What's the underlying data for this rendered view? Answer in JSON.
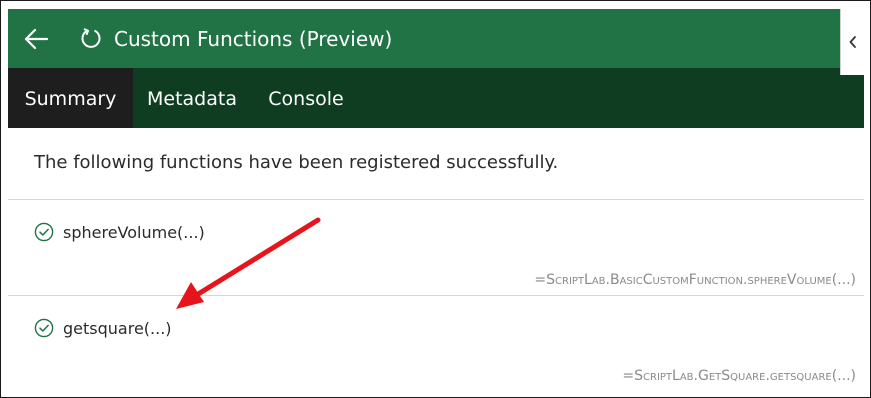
{
  "header": {
    "title": "Custom Functions (Preview)",
    "back_icon": "back-arrow-icon",
    "refresh_icon": "refresh-icon",
    "collapse_icon": "chevron-left-icon",
    "colors": {
      "header_bg": "#217346",
      "tabbar_bg": "#0f3d22",
      "active_tab_bg": "#1e1e1e"
    }
  },
  "tabs": [
    {
      "label": "Summary",
      "active": true
    },
    {
      "label": "Metadata",
      "active": false
    },
    {
      "label": "Console",
      "active": false
    }
  ],
  "main": {
    "message": "The following functions have been registered successfully.",
    "functions": [
      {
        "name": "sphereVolume(...)",
        "formula": "=ScriptLab.BasicCustomFunction.sphereVolume(...)",
        "status_icon": "check-circle-icon"
      },
      {
        "name": "getsquare(...)",
        "formula": "=ScriptLab.GetSquare.getsquare(...)",
        "status_icon": "check-circle-icon"
      }
    ]
  },
  "annotation": {
    "type": "red-arrow",
    "color": "#e8141b"
  }
}
